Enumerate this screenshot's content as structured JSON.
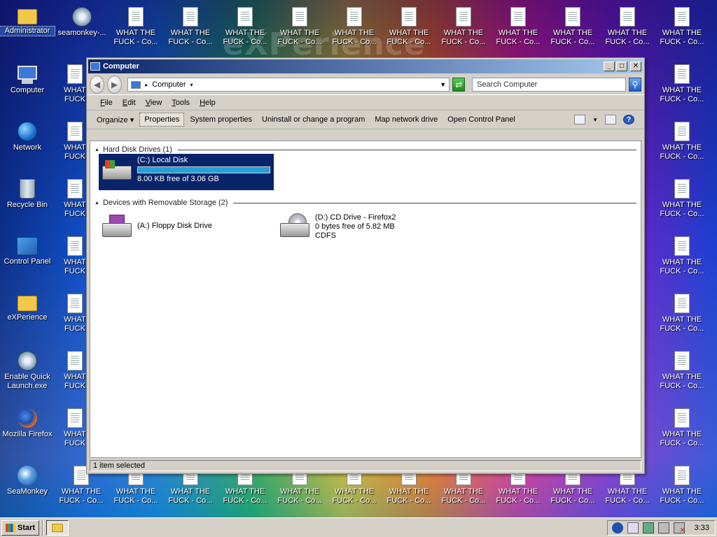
{
  "desktop": {
    "watermark": "eXPerience",
    "left_icons": [
      {
        "label": "Administrator",
        "icon": "folder-icon",
        "kind": "folder"
      },
      {
        "label": "Computer",
        "icon": "computer-icon",
        "kind": "monitor"
      },
      {
        "label": "Network",
        "icon": "network-globe-icon",
        "kind": "globe"
      },
      {
        "label": "Recycle Bin",
        "icon": "recycle-bin-icon",
        "kind": "bin"
      },
      {
        "label": "Control Panel",
        "icon": "control-panel-icon",
        "kind": "cpanel"
      },
      {
        "label": "eXPerience",
        "icon": "folder-icon",
        "kind": "folder"
      },
      {
        "label": "Enable Quick\nLaunch.exe",
        "icon": "quick-launch-icon",
        "kind": "ql"
      },
      {
        "label": "Mozilla Firefox",
        "icon": "firefox-icon",
        "kind": "fx"
      },
      {
        "label": "SeaMonkey",
        "icon": "seamonkey-icon",
        "kind": "sm"
      }
    ],
    "seamonkey_top": "seamonkey-...",
    "file_label_full": "WHAT THE\nFUCK - Co...",
    "file_label_partial": "WHAT\nFUCK"
  },
  "window": {
    "title": "Computer",
    "controls": {
      "minimize": "_",
      "maximize": "□",
      "close": "✕"
    },
    "address": "Computer",
    "search_placeholder": "Search Computer",
    "menu": [
      "File",
      "Edit",
      "View",
      "Tools",
      "Help"
    ],
    "commands": [
      "Organize ▾",
      "Properties",
      "System properties",
      "Uninstall or change a program",
      "Map network drive",
      "Open Control Panel"
    ],
    "groups": [
      {
        "title": "Hard Disk Drives (1)"
      },
      {
        "title": "Devices with Removable Storage (2)"
      }
    ],
    "drives": {
      "local": {
        "name": "(C:) Local Disk",
        "free": "8.00 KB free of 3.06 GB",
        "used_fraction": 1.0
      },
      "floppy": {
        "name": "(A:) Floppy Disk Drive"
      },
      "cd": {
        "name": "(D:) CD Drive - Firefox2",
        "free": "0 bytes free of 5.82 MB",
        "fs": "CDFS"
      }
    },
    "status": "1 item selected"
  },
  "taskbar": {
    "start": "Start",
    "clock": "3:33"
  },
  "colors": {
    "selection": "#0a246a",
    "title_start": "#0a246a",
    "title_end": "#a6caf0"
  }
}
